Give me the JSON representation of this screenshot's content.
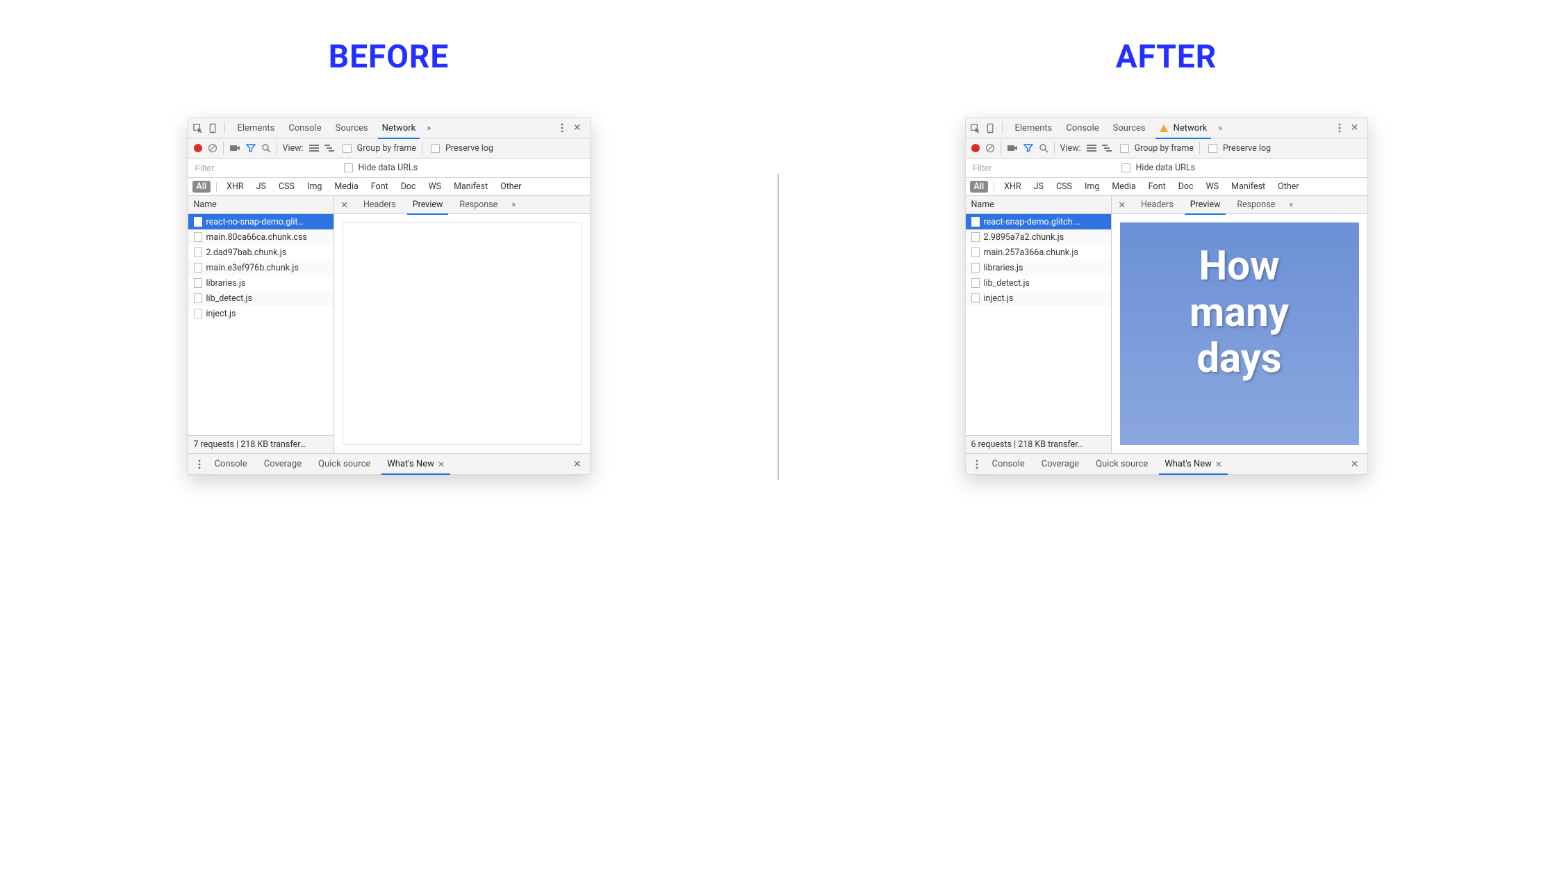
{
  "left_title": "BEFORE",
  "right_title": "AFTER",
  "topTabs": {
    "elements": "Elements",
    "console": "Console",
    "sources": "Sources",
    "network": "Network"
  },
  "toolbar": {
    "view": "View:",
    "group": "Group by frame",
    "preserve": "Preserve log"
  },
  "filter": {
    "placeholder": "Filter",
    "hide": "Hide data URLs"
  },
  "types": [
    "All",
    "XHR",
    "JS",
    "CSS",
    "Img",
    "Media",
    "Font",
    "Doc",
    "WS",
    "Manifest",
    "Other"
  ],
  "colName": "Name",
  "detailTabs": {
    "headers": "Headers",
    "preview": "Preview",
    "response": "Response"
  },
  "drawerTabs": {
    "console": "Console",
    "coverage": "Coverage",
    "quick": "Quick source",
    "whatsnew": "What's New"
  },
  "before": {
    "requests": [
      "react-no-snap-demo.glit…",
      "main.80ca66ca.chunk.css",
      "2.dad97bab.chunk.js",
      "main.e3ef976b.chunk.js",
      "libraries.js",
      "lib_detect.js",
      "inject.js"
    ],
    "status": "7 requests | 218 KB transfer…"
  },
  "after": {
    "requests": [
      "react-snap-demo.glitch.…",
      "2.9895a7a2.chunk.js",
      "main.257a366a.chunk.js",
      "libraries.js",
      "lib_detect.js",
      "inject.js"
    ],
    "status": "6 requests | 218 KB transfer…",
    "previewText": [
      "How",
      "many",
      "days"
    ]
  }
}
